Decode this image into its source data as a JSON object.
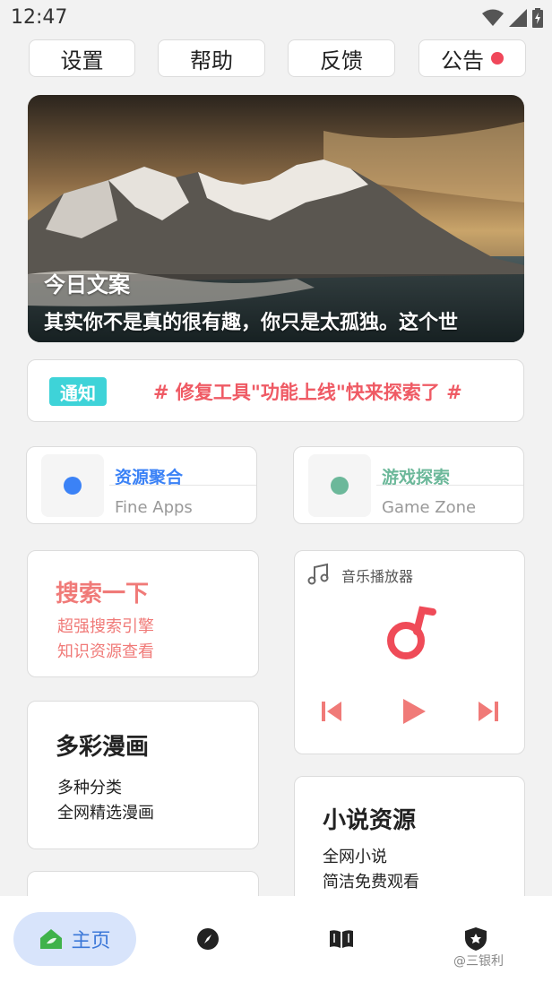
{
  "status_bar": {
    "time": "12:47"
  },
  "top_buttons": {
    "settings": "设置",
    "help": "帮助",
    "feedback": "反馈",
    "announcement": "公告"
  },
  "banner": {
    "title": "今日文案",
    "text": "其实你不是真的很有趣，你只是太孤独。这个世"
  },
  "notice": {
    "badge": "通知",
    "text": "# 修复工具\"功能上线\"快来探索了 #"
  },
  "apps": [
    {
      "title": "资源聚合",
      "subtitle": "Fine Apps",
      "color": "#3b82f6"
    },
    {
      "title": "游戏探索",
      "subtitle": "Game Zone",
      "color": "#6cb89a"
    }
  ],
  "search_card": {
    "title": "搜索一下",
    "line1": "超强搜索引擎",
    "line2": "知识资源查看",
    "color": "#f07a78"
  },
  "comic_card": {
    "title": "多彩漫画",
    "line1": "多种分类",
    "line2": "全网精选漫画"
  },
  "music_card": {
    "title": "音乐播放器",
    "accent": "#ef4b58"
  },
  "novel_card": {
    "title": "小说资源",
    "line1": "全网小说",
    "line2": "简洁免费观看"
  },
  "bottom_nav": {
    "home_label": "主页",
    "watermark": "@三银利"
  }
}
